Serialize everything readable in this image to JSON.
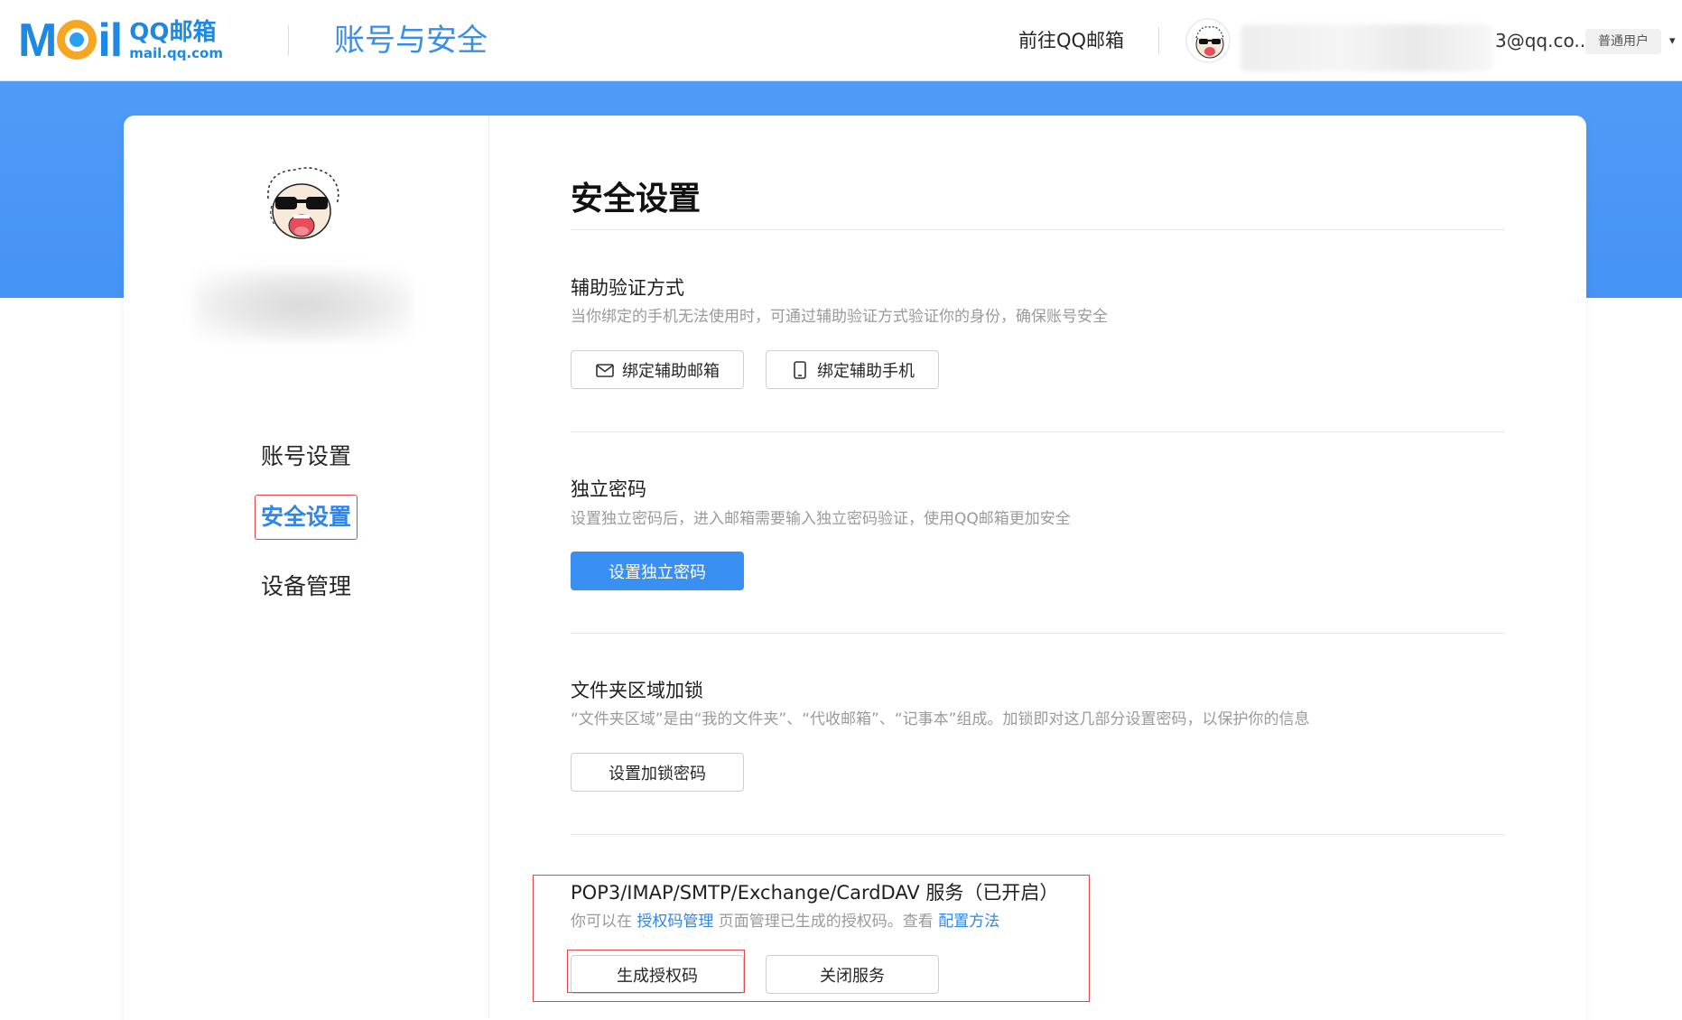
{
  "header": {
    "logo_text": "Mail",
    "logo_cn": "QQ邮箱",
    "logo_domain": "mail.qq.com",
    "page_title": "账号与安全",
    "goto_mail": "前往QQ邮箱",
    "email_tail": "3@qq.co...",
    "user_badge": "普通用户",
    "caret": "▾"
  },
  "sidebar": {
    "items": [
      {
        "label": "账号设置"
      },
      {
        "label": "安全设置",
        "active": true
      },
      {
        "label": "设备管理"
      }
    ]
  },
  "main": {
    "title": "安全设置",
    "sections": [
      {
        "title": "辅助验证方式",
        "desc": "当你绑定的手机无法使用时，可通过辅助验证方式验证你的身份，确保账号安全",
        "buttons": [
          "绑定辅助邮箱",
          "绑定辅助手机"
        ]
      },
      {
        "title": "独立密码",
        "desc": "设置独立密码后，进入邮箱需要输入独立密码验证，使用QQ邮箱更加安全",
        "buttons": [
          "设置独立密码"
        ]
      },
      {
        "title": "文件夹区域加锁",
        "desc": "“文件夹区域”是由“我的文件夹”、“代收邮箱”、“记事本”组成。加锁即对这几部分设置密码，以保护你的信息",
        "buttons": [
          "设置加锁密码"
        ]
      },
      {
        "title": "POP3/IMAP/SMTP/Exchange/CardDAV 服务（已开启）",
        "desc_prefix": "你可以在 ",
        "desc_link1": "授权码管理",
        "desc_middle": " 页面管理已生成的授权码。查看 ",
        "desc_link2": "配置方法",
        "buttons": [
          "生成授权码",
          "关闭服务"
        ]
      }
    ]
  },
  "colors": {
    "brand_blue": "#3a8ff2",
    "band_blue": "#4f9bf7",
    "annotation_red": "#e04848"
  }
}
